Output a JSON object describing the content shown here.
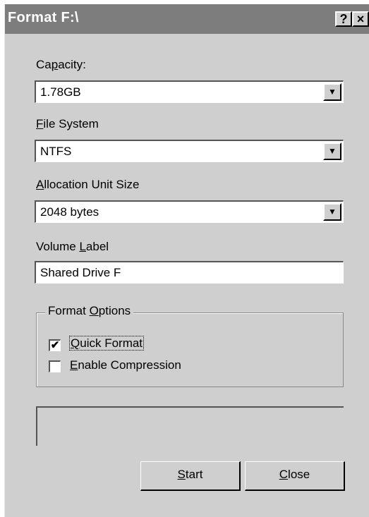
{
  "window": {
    "title": "Format F:\\",
    "help_button": "?",
    "close_button": "×"
  },
  "capacity": {
    "label_pre": "Ca",
    "label_key": "p",
    "label_post": "acity:",
    "value": "1.78GB"
  },
  "file_system": {
    "label_key": "F",
    "label_post": "ile System",
    "value": "NTFS"
  },
  "allocation": {
    "label_key": "A",
    "label_post": "llocation Unit Size",
    "value": "2048 bytes"
  },
  "volume_label": {
    "label_pre": "Volume ",
    "label_key": "L",
    "label_post": "abel",
    "value": "Shared Drive F"
  },
  "format_options": {
    "legend_pre": "Format ",
    "legend_key": "O",
    "legend_post": "ptions",
    "quick_format": {
      "checked": true,
      "mark": "✔",
      "label_key": "Q",
      "label_post": "uick Format"
    },
    "compression": {
      "checked": false,
      "mark": "",
      "label_key": "E",
      "label_post": "nable Compression"
    }
  },
  "buttons": {
    "start": {
      "label_key": "S",
      "label_post": "tart"
    },
    "close": {
      "label_key": "C",
      "label_post": "lose"
    }
  }
}
